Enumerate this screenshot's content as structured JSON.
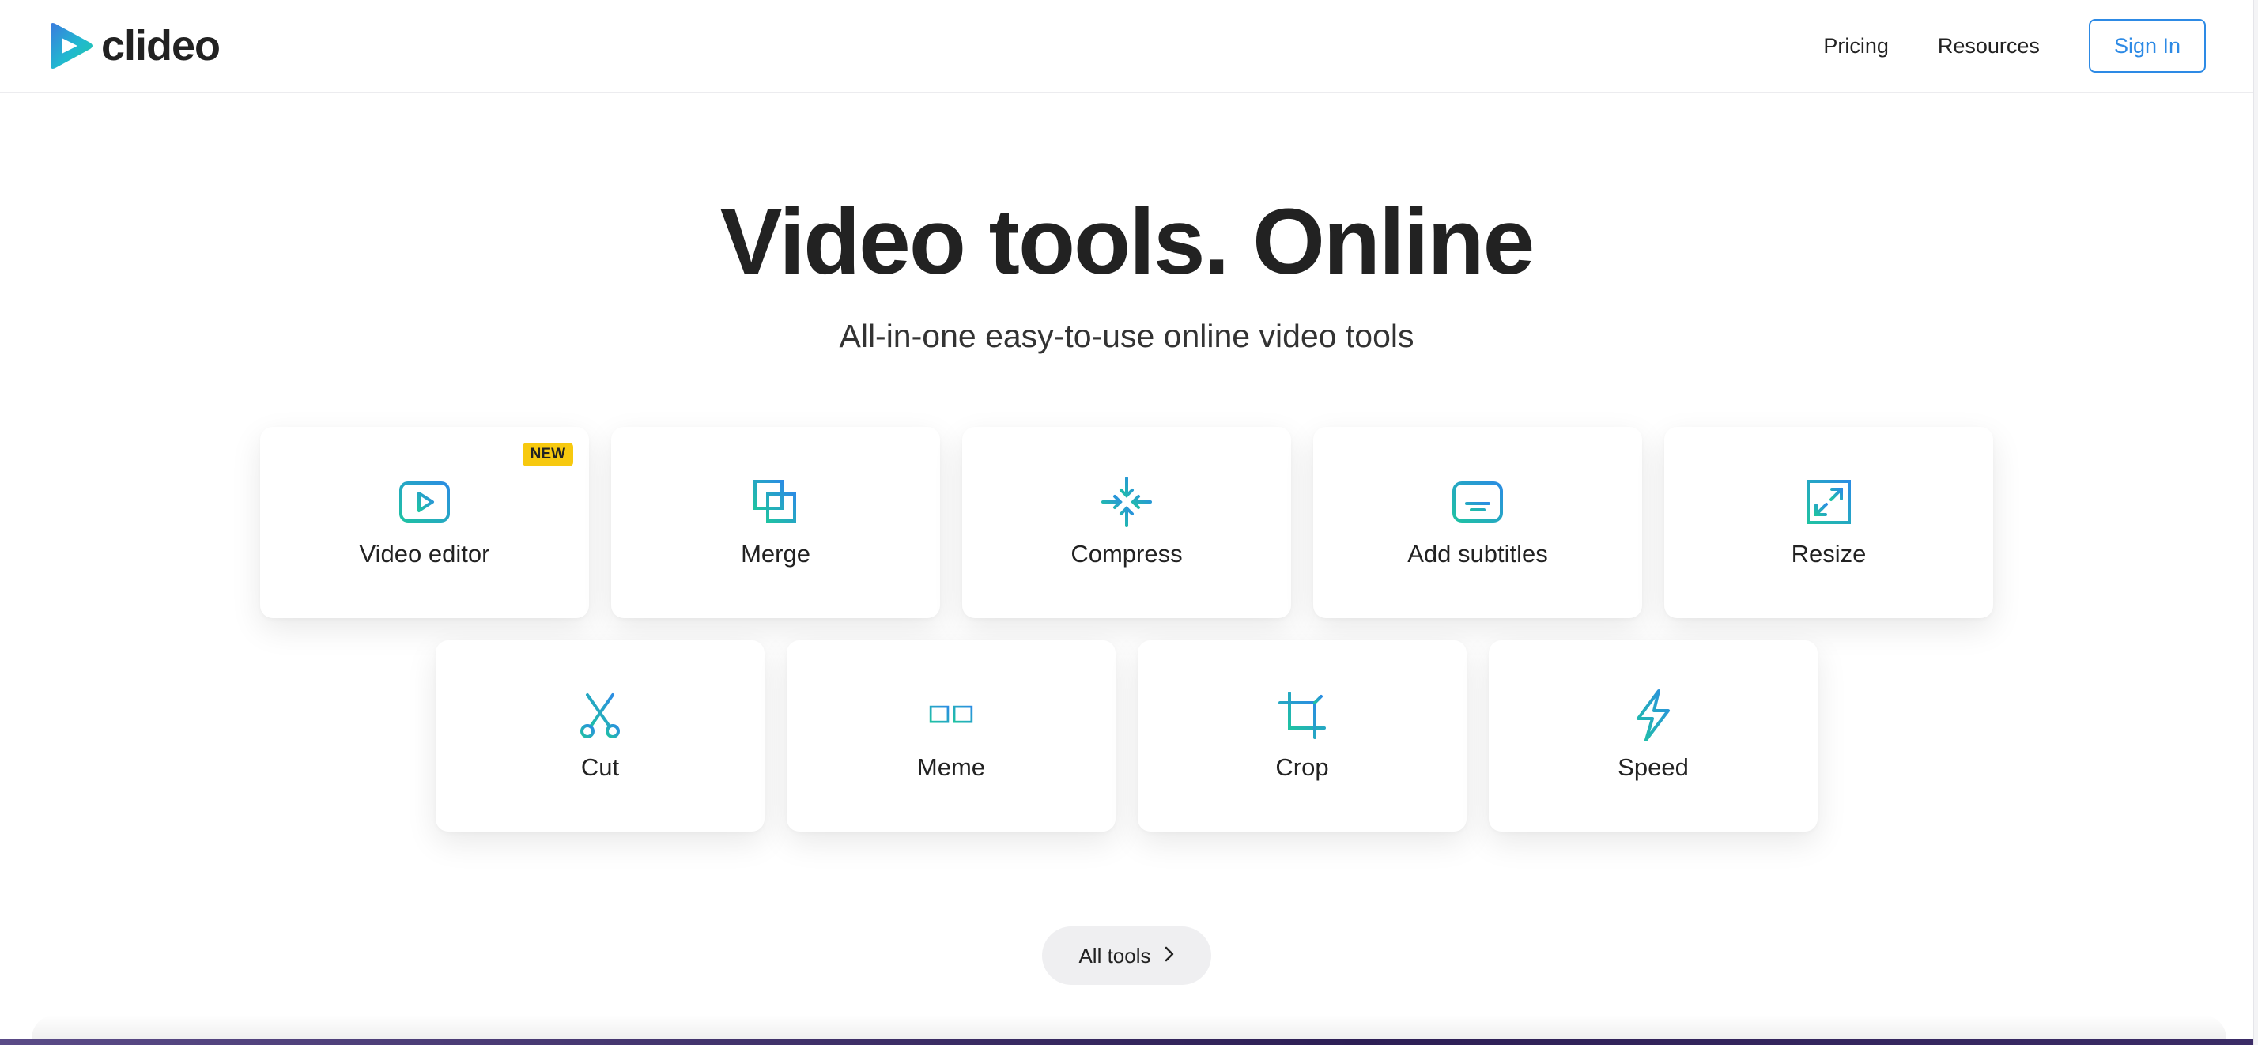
{
  "header": {
    "brand": "clideo",
    "nav": {
      "pricing": "Pricing",
      "resources": "Resources",
      "signin": "Sign In"
    }
  },
  "hero": {
    "title": "Video tools. Online",
    "subtitle": "All-in-one easy-to-use online video tools"
  },
  "tools": [
    {
      "label": "Video editor",
      "icon": "play-icon",
      "badge": "NEW"
    },
    {
      "label": "Merge",
      "icon": "merge-icon"
    },
    {
      "label": "Compress",
      "icon": "compress-icon"
    },
    {
      "label": "Add subtitles",
      "icon": "subtitles-icon"
    },
    {
      "label": "Resize",
      "icon": "resize-icon"
    },
    {
      "label": "Cut",
      "icon": "scissors-icon"
    },
    {
      "label": "Meme",
      "icon": "meme-icon"
    },
    {
      "label": "Crop",
      "icon": "crop-icon"
    },
    {
      "label": "Speed",
      "icon": "lightning-icon"
    }
  ],
  "all_tools_label": "All tools",
  "colors": {
    "accent": "#2d8ae5",
    "icon_start": "#1fc2a3",
    "icon_end": "#2b8de3",
    "badge": "#f7c90f"
  }
}
